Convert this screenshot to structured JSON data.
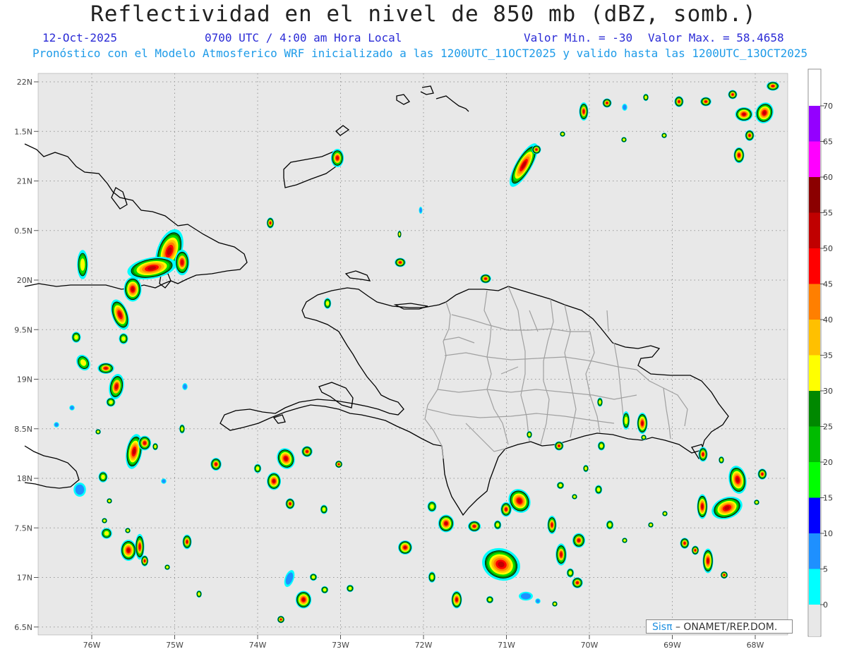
{
  "header": {
    "title": "Reflectividad en el nivel de 850 mb (dBZ, somb.)",
    "date": "12-Oct-2025",
    "time": "0700 UTC / 4:00 am Hora Local",
    "min_value": "Valor Min. = -30",
    "max_value": "Valor Max. = 58.4658",
    "model_info": "Pronóstico con el Modelo Atmosferico WRF inicializado a las 1200UTC_11OCT2025 y valido hasta las  1200UTC_13OCT2025"
  },
  "axes": {
    "lat_labels": [
      "22N",
      "1.5N",
      "21N",
      "0.5N",
      "20N",
      "9.5N",
      "19N",
      "8.5N",
      "18N",
      "7.5N",
      "17N",
      "6.5N"
    ],
    "lat_values": [
      22,
      21.5,
      21,
      20.5,
      20,
      19.5,
      19,
      18.5,
      18,
      17.5,
      17,
      16.5
    ],
    "lon_labels": [
      "76W",
      "75W",
      "74W",
      "73W",
      "72W",
      "71W",
      "70W",
      "69W",
      "68W"
    ],
    "lon_values": [
      -76,
      -75,
      -74,
      -73,
      -72,
      -71,
      -70,
      -69,
      -68
    ]
  },
  "colorbar": {
    "labels": [
      "70",
      "65",
      "60",
      "55",
      "50",
      "45",
      "40",
      "35",
      "30",
      "25",
      "20",
      "15",
      "10",
      "5",
      "0"
    ],
    "colors": [
      "#9400ff",
      "#ff00ff",
      "#8b0000",
      "#c00000",
      "#ff0000",
      "#ff7f00",
      "#ffc000",
      "#ffff00",
      "#008800",
      "#00bb00",
      "#00ff00",
      "#0000ff",
      "#1e90ff",
      "#00ffff",
      "#e8e8e8"
    ]
  },
  "credit": {
    "sis": "Sisπ",
    "org": "– ONAMET/REP.DOM."
  },
  "colors": {
    "background": "#e8e8e8",
    "coast": "#000000",
    "provinces": "#a0a0a0"
  }
}
